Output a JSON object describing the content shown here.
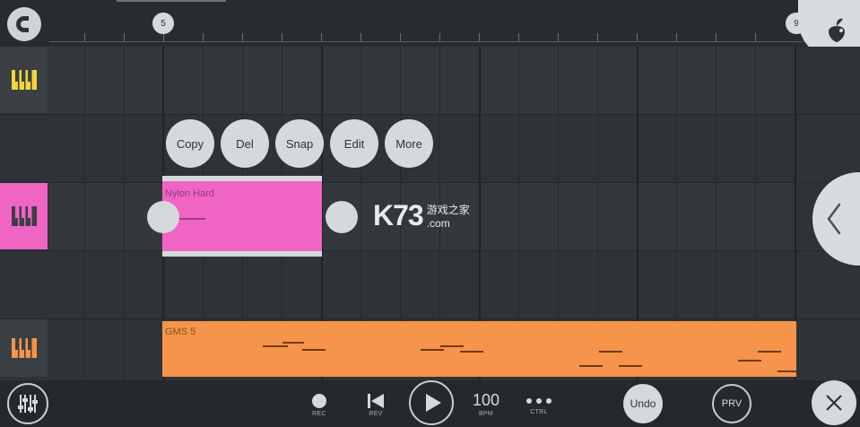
{
  "timeline": {
    "position_marker_left": "5",
    "position_marker_right": "9"
  },
  "context_menu": {
    "items": [
      "Copy",
      "Del",
      "Snap",
      "Edit",
      "More"
    ]
  },
  "tracks": [
    {
      "name": "piano-yellow",
      "color": "#f3d43c"
    },
    {
      "name": "piano-pink",
      "color": "#f064c4"
    },
    {
      "name": "piano-orange",
      "color": "#f5944a"
    }
  ],
  "clips": {
    "pink": {
      "label": "Nylon Hard",
      "color": "#f064c4"
    },
    "orange": {
      "label": "GMS 5",
      "color": "#f5944a"
    }
  },
  "watermark": {
    "logo": "K73",
    "chinese": "游戏之家",
    "domain": ".com"
  },
  "transport": {
    "rec_label": "REC",
    "rev_label": "REV",
    "tempo": "100",
    "bpm_label": "BPM",
    "ctrl_label": "CTRL",
    "undo_label": "Undo",
    "prv_label": "PRV"
  },
  "colors": {
    "background": "#2b3034",
    "bubble": "#d6d9dc"
  }
}
